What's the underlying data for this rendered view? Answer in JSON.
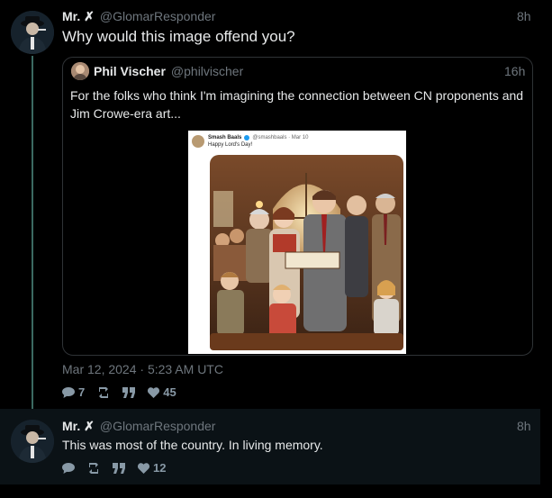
{
  "main_tweet": {
    "name": "Mr. ✗",
    "handle": "@GlomarResponder",
    "time": "8h",
    "text": "Why would this image offend you?",
    "date": "Mar 12, 2024 · 5:23 AM UTC",
    "stats": {
      "replies": "7",
      "likes": "45"
    }
  },
  "quoted_tweet": {
    "name": "Phil Vischer",
    "handle": "@philvischer",
    "time": "16h",
    "text": "For the folks who think I'm imagining the connection between CN proponents and Jim Crowe-era art...",
    "embedded_post": {
      "name": "Smash Baals",
      "handle": "@smashbaals · Mar 10",
      "text": "Happy Lord's Day!"
    }
  },
  "reply_tweet": {
    "name": "Mr. ✗",
    "handle": "@GlomarResponder",
    "time": "8h",
    "text": "This was most of the country. In living memory.",
    "stats": {
      "likes": "12"
    }
  },
  "colors": {
    "background": "#000000",
    "muted": "#6e767d",
    "border": "#2f3336",
    "thread": "#3b6a62",
    "reply_bg": "#0b1216"
  },
  "icons": [
    "reply-icon",
    "retweet-icon",
    "quote-icon",
    "like-icon",
    "verified-icon"
  ]
}
